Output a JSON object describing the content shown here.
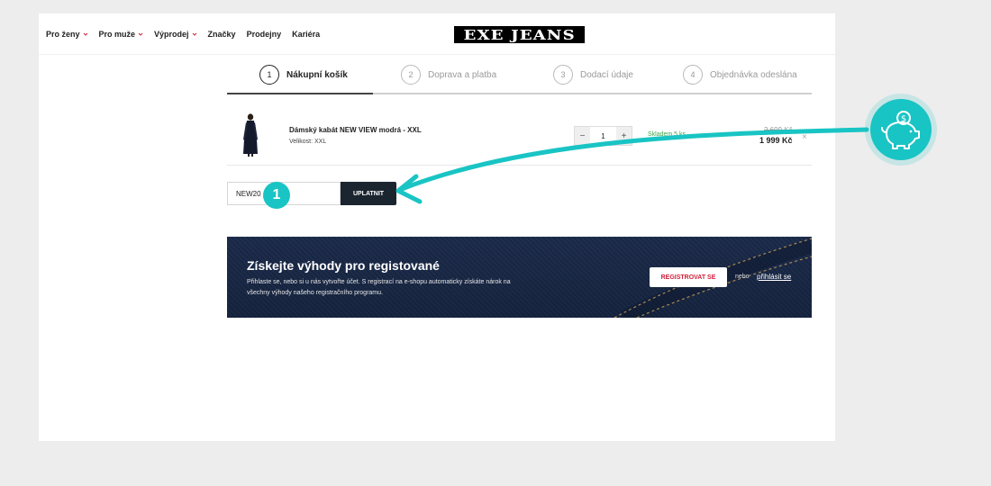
{
  "nav": {
    "items": [
      {
        "label": "Pro ženy",
        "has_dropdown": true
      },
      {
        "label": "Pro muže",
        "has_dropdown": true
      },
      {
        "label": "Výprodej",
        "has_dropdown": true
      },
      {
        "label": "Značky",
        "has_dropdown": false
      },
      {
        "label": "Prodejny",
        "has_dropdown": false
      },
      {
        "label": "Kariéra",
        "has_dropdown": false
      }
    ]
  },
  "logo": {
    "text": "EXE JEANS"
  },
  "steps": [
    {
      "num": "1",
      "label": "Nákupní košík",
      "active": true
    },
    {
      "num": "2",
      "label": "Doprava a platba",
      "active": false
    },
    {
      "num": "3",
      "label": "Dodací údaje",
      "active": false
    },
    {
      "num": "4",
      "label": "Objednávka odeslána",
      "active": false
    }
  ],
  "cart": {
    "item": {
      "name": "Dámský kabát NEW VIEW modrá - XXL",
      "size": "Velikost: XXL",
      "qty_minus": "−",
      "quantity": "1",
      "qty_plus": "+",
      "stock": "Skladem 5 ks",
      "old_price": "2 699 Kč",
      "price": "1 999 Kč",
      "remove": "×"
    }
  },
  "coupon": {
    "value": "NEW20",
    "button": "UPLATNIT"
  },
  "banner": {
    "title": "Získejte výhody pro registované",
    "text": "Přihlaste se, nebo si u nás vytvořte účet. S registrací na e-shopu automaticky získáte nárok na všechny výhody našeho registračního programu.",
    "register_button": "REGISTROVAT SE",
    "or": "nebo",
    "login_link": "přihlásit se"
  },
  "annotation": {
    "badge": "1",
    "icon": "piggy-bank-icon",
    "accent": "#19c4c4"
  },
  "colors": {
    "button_dark": "#1b2530",
    "stock_green": "#3fa34d",
    "register_red": "#d0203a",
    "banner_bg": "#1b2a4a"
  }
}
